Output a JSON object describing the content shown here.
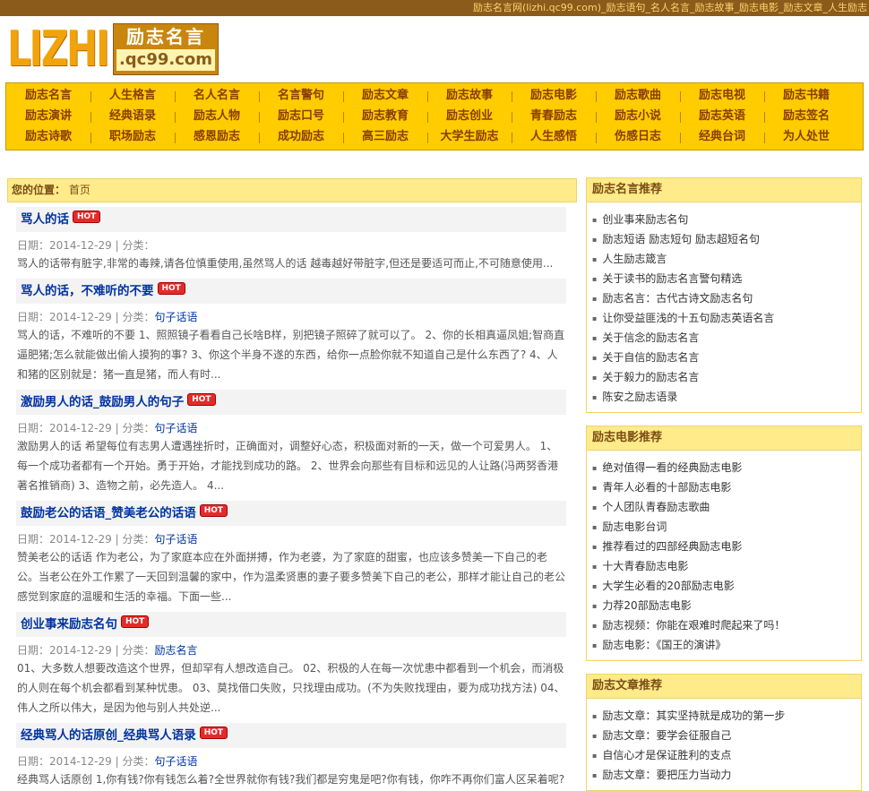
{
  "topbar": {
    "text": "励志名言网(lizhi.qc99.com)_励志语句_名人名言_励志故事_励志电影_励志文章_人生励志"
  },
  "logo": {
    "left": "LIZHI",
    "right_top": "励志名言",
    "right_bottom": ".qc99.com"
  },
  "nav": {
    "rows": [
      [
        "励志名言",
        "人生格言",
        "名人名言",
        "名言警句",
        "励志文章",
        "励志故事",
        "励志电影",
        "励志歌曲",
        "励志电视",
        "励志书籍"
      ],
      [
        "励志演讲",
        "经典语录",
        "励志人物",
        "励志口号",
        "励志教育",
        "励志创业",
        "青春励志",
        "励志小说",
        "励志英语",
        "励志签名"
      ],
      [
        "励志诗歌",
        "职场励志",
        "感恩励志",
        "成功励志",
        "高三励志",
        "大学生励志",
        "人生感悟",
        "伤感日志",
        "经典台词",
        "为人处世"
      ]
    ]
  },
  "breadcrumb": {
    "label": "您的位置：",
    "home": "首页"
  },
  "articles": [
    {
      "title": "骂人的话",
      "hot": "HOT",
      "date": "日期：2014-12-29",
      "sep": "|",
      "cat_label": "分类：",
      "cat": "",
      "summary": "骂人的话带有脏字,非常的毒辣,请各位慎重使用,虽然骂人的话 越毒越好带脏字,但还是要适可而止,不可随意使用..."
    },
    {
      "title": "骂人的话，不难听的不要",
      "hot": "HOT",
      "date": "日期：2014-12-29",
      "sep": "|",
      "cat_label": "分类：",
      "cat": "句子话语",
      "summary": "骂人的话，不难听的不要 1、照照镜子看看自己长啥B样，别把镜子照碎了就可以了。 2、你的长相真逼凤姐;智商直逼肥猪;怎么就能做出偷人摸狗的事? 3、你这个半身不遂的东西，给你一点脸你就不知道自己是什么东西了? 4、人和猪的区别就是：猪一直是猪，而人有时..."
    },
    {
      "title": "激励男人的话_鼓励男人的句子",
      "hot": "HOT",
      "date": "日期：2014-12-29",
      "sep": "|",
      "cat_label": "分类：",
      "cat": "句子话语",
      "summary": "激励男人的话 希望每位有志男人遭遇挫折时，正确面对，调整好心态，积极面对新的一天，做一个可爱男人。 1、每一个成功者都有一个开始。勇于开始，才能找到成功的路。 2、世界会向那些有目标和远见的人让路(冯两努香港著名推销商) 3、造物之前，必先造人。 4..."
    },
    {
      "title": "鼓励老公的话语_赞美老公的话语",
      "hot": "HOT",
      "date": "日期：2014-12-29",
      "sep": "|",
      "cat_label": "分类：",
      "cat": "句子话语",
      "summary": "赞美老公的话语 作为老公，为了家庭本应在外面拼搏，作为老婆，为了家庭的甜蜜，也应该多赞美一下自己的老公。当老公在外工作累了一天回到温馨的家中，作为温柔贤惠的妻子要多赞美下自己的老公，那样才能让自己的老公感觉到家庭的温暖和生活的幸福。下面一些..."
    },
    {
      "title": "创业事来励志名句",
      "hot": "HOT",
      "date": "日期：2014-12-29",
      "sep": "|",
      "cat_label": "分类：",
      "cat": "励志名言",
      "summary": "01、大多数人想要改造这个世界，但却罕有人想改造自己。 02、积极的人在每一次忧患中都看到一个机会，而消极的人则在每个机会都看到某种忧患。 03、莫找借口失败，只找理由成功。(不为失败找理由，要为成功找方法) 04、伟人之所以伟大，是因为他与别人共处逆..."
    },
    {
      "title": "经典骂人的话原创_经典骂人语录",
      "hot": "HOT",
      "date": "日期：2014-12-29",
      "sep": "|",
      "cat_label": "分类：",
      "cat": "句子话语",
      "summary": "经典骂人话原创 1,你有钱?你有钱怎么着?全世界就你有钱?我们都是穷鬼是吧?你有钱，你咋不再你们富人区呆着呢?"
    }
  ],
  "sidebar": [
    {
      "title": "励志名言推荐",
      "items": [
        "创业事来励志名句",
        "励志短语 励志短句 励志超短名句",
        "人生励志箴言",
        "关于读书的励志名言警句精选",
        "励志名言：古代古诗文励志名句",
        "让你受益匪浅的十五句励志英语名言",
        "关于信念的励志名言",
        "关于自信的励志名言",
        "关于毅力的励志名言",
        "陈安之励志语录"
      ]
    },
    {
      "title": "励志电影推荐",
      "items": [
        "绝对值得一看的经典励志电影",
        "青年人必看的十部励志电影",
        "个人团队青春励志歌曲",
        "励志电影台词",
        "推荐看过的四部经典励志电影",
        "十大青春励志电影",
        "大学生必看的20部励志电影",
        "力荐20部励志电影",
        "励志视频：你能在艰难时爬起来了吗！",
        "励志电影：《国王的演讲》"
      ]
    },
    {
      "title": "励志文章推荐",
      "items": [
        "励志文章：其实坚持就是成功的第一步",
        "励志文章：要学会征服自己",
        "自信心才是保证胜利的支点",
        "励志文章：要把压力当动力"
      ]
    }
  ],
  "colors": {
    "topbar_bg": "#8a5b1b",
    "nav_bg": "#ffcc00",
    "link": "#0033a0",
    "box_header_bg": "#ffeb8a",
    "hot": "#e42b2b"
  }
}
